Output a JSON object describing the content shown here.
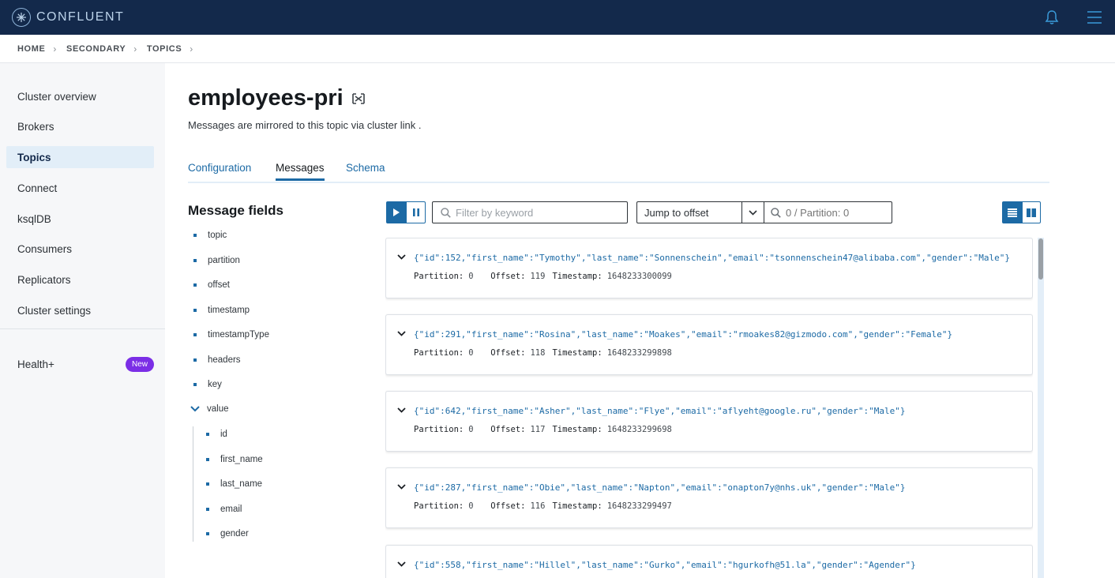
{
  "brand": {
    "name": "CONFLUENT",
    "colors": {
      "topbar": "#13294b",
      "accent": "#1c6aa5",
      "badge": "#7b2ee6"
    }
  },
  "topbar": {
    "icons": [
      "bell-icon",
      "hamburger-menu-icon"
    ]
  },
  "breadcrumb": {
    "items": [
      "HOME",
      "SECONDARY",
      "TOPICS"
    ]
  },
  "sidebar": {
    "items": [
      {
        "label": "Cluster overview"
      },
      {
        "label": "Brokers"
      },
      {
        "label": "Topics",
        "active": true
      },
      {
        "label": "Connect"
      },
      {
        "label": "ksqlDB"
      },
      {
        "label": "Consumers"
      },
      {
        "label": "Replicators"
      },
      {
        "label": "Cluster settings"
      }
    ],
    "health": {
      "label": "Health+",
      "badge": "New"
    }
  },
  "page": {
    "title": "employees-pri",
    "subtitle": "Messages are mirrored to this topic via cluster link ."
  },
  "tabs": [
    {
      "label": "Configuration",
      "active": false
    },
    {
      "label": "Messages",
      "active": true
    },
    {
      "label": "Schema",
      "active": false
    }
  ],
  "message_fields": {
    "title": "Message fields",
    "items": [
      "topic",
      "partition",
      "offset",
      "timestamp",
      "timestampType",
      "headers",
      "key"
    ],
    "value": {
      "label": "value",
      "expanded": true,
      "children": [
        "id",
        "first_name",
        "last_name",
        "email",
        "gender"
      ]
    }
  },
  "toolbar": {
    "filter_placeholder": "Filter by keyword",
    "jump_label": "Jump to offset",
    "offset_placeholder": "0 / Partition: 0"
  },
  "meta_labels": {
    "partition": "Partition:",
    "offset": "Offset:",
    "timestamp": "Timestamp:"
  },
  "messages": [
    {
      "value": "{\"id\":152,\"first_name\":\"Tymothy\",\"last_name\":\"Sonnenschein\",\"email\":\"tsonnenschein47@alibaba.com\",\"gender\":\"Male\"}",
      "partition": "0",
      "offset": "119",
      "timestamp": "1648233300099"
    },
    {
      "value": "{\"id\":291,\"first_name\":\"Rosina\",\"last_name\":\"Moakes\",\"email\":\"rmoakes82@gizmodo.com\",\"gender\":\"Female\"}",
      "partition": "0",
      "offset": "118",
      "timestamp": "1648233299898"
    },
    {
      "value": "{\"id\":642,\"first_name\":\"Asher\",\"last_name\":\"Flye\",\"email\":\"aflyeht@google.ru\",\"gender\":\"Male\"}",
      "partition": "0",
      "offset": "117",
      "timestamp": "1648233299698"
    },
    {
      "value": "{\"id\":287,\"first_name\":\"Obie\",\"last_name\":\"Napton\",\"email\":\"onapton7y@nhs.uk\",\"gender\":\"Male\"}",
      "partition": "0",
      "offset": "116",
      "timestamp": "1648233299497"
    },
    {
      "value": "{\"id\":558,\"first_name\":\"Hillel\",\"last_name\":\"Gurko\",\"email\":\"hgurkofh@51.la\",\"gender\":\"Agender\"}",
      "partition": "",
      "offset": "",
      "timestamp": ""
    }
  ]
}
